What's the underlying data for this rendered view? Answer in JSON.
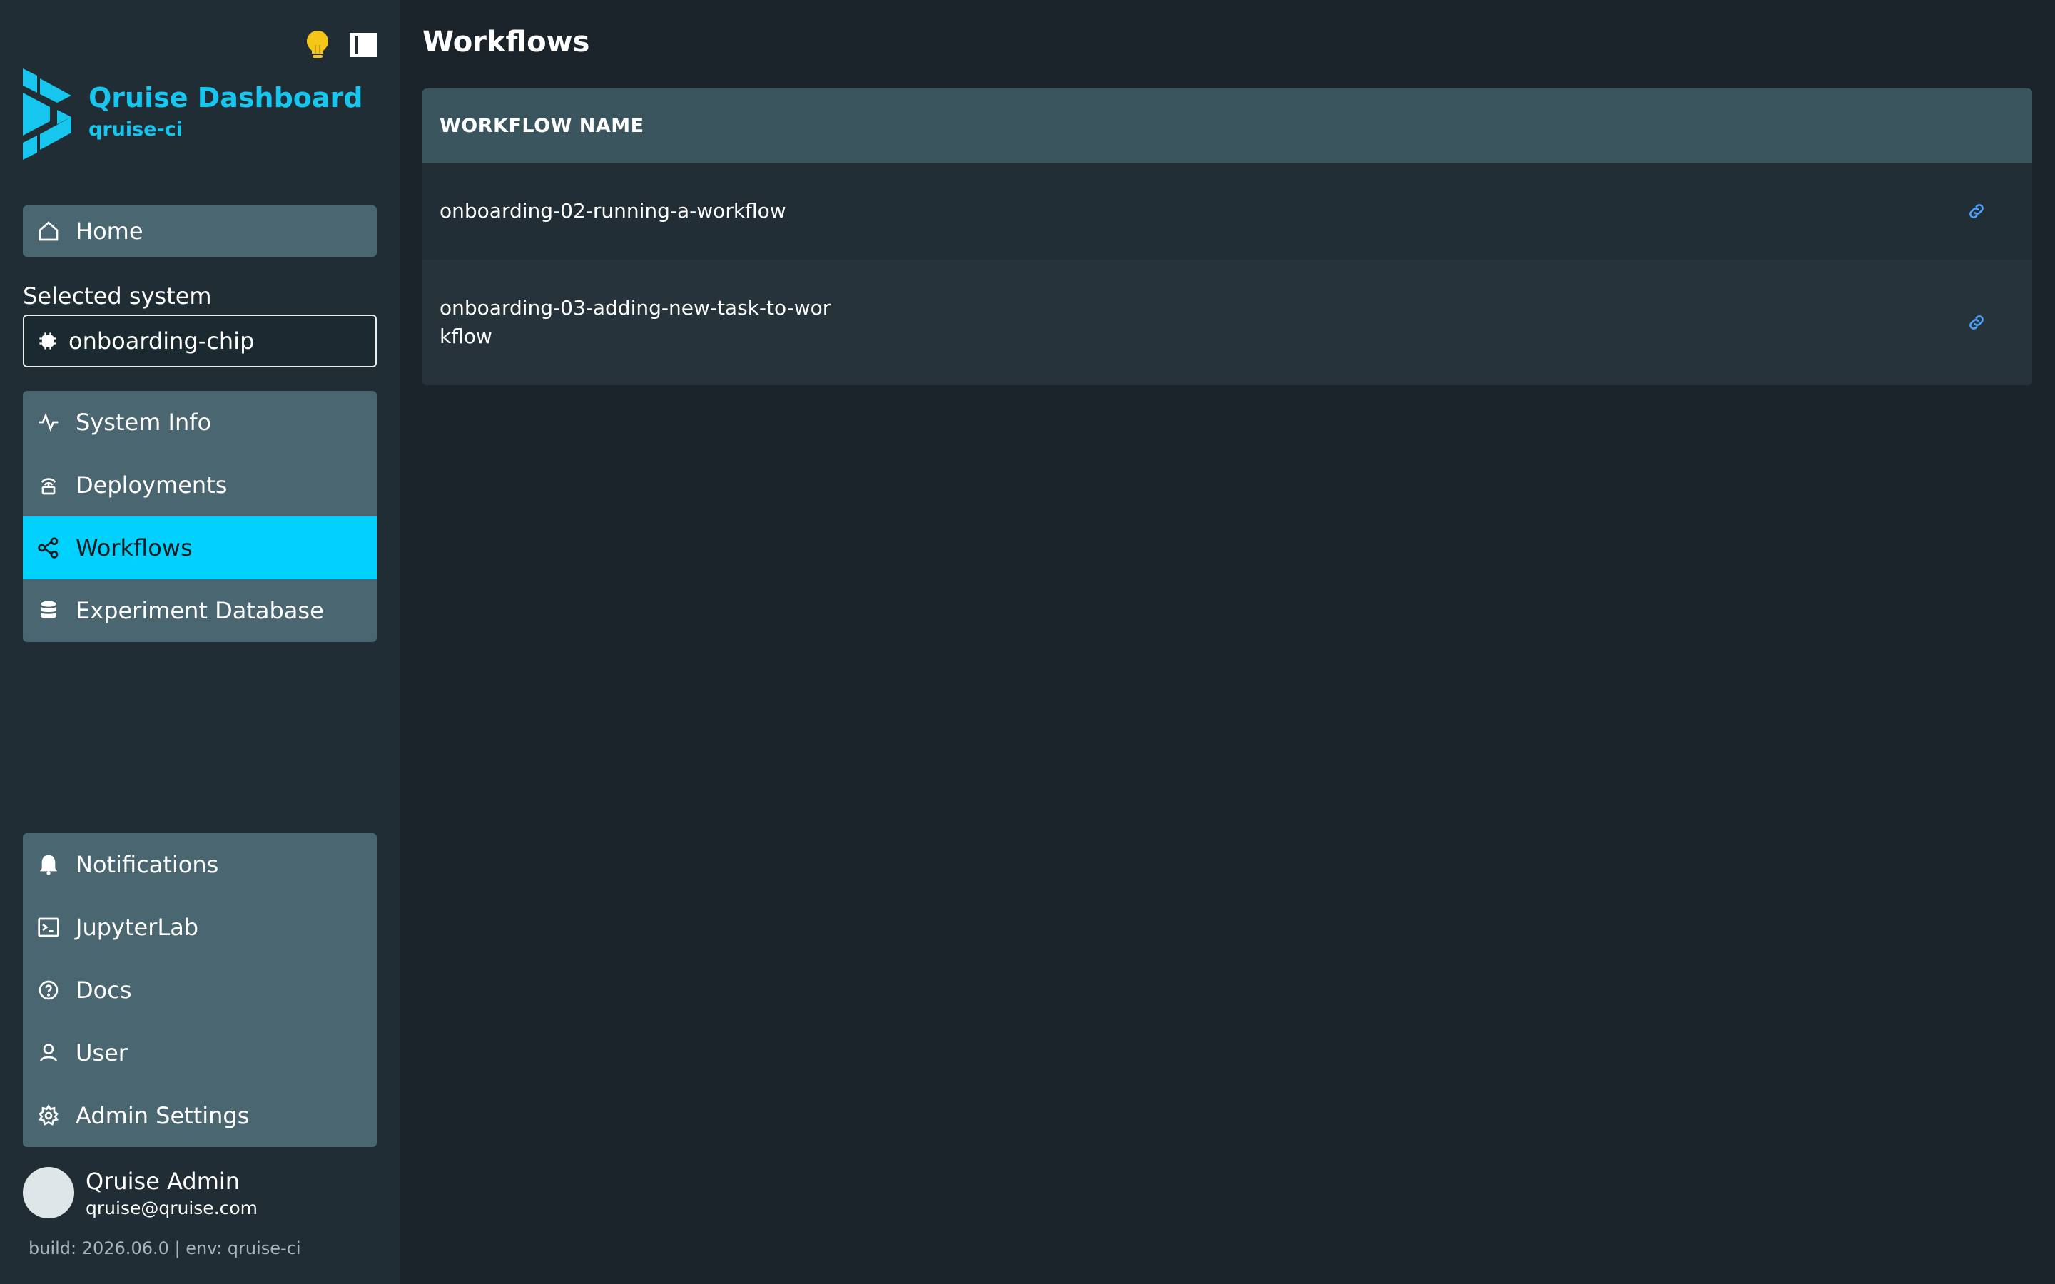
{
  "app": {
    "title": "Qruise Dashboard",
    "subtitle": "qruise-ci"
  },
  "top_icons": [
    "lightbulb-icon",
    "sidebar-toggle-icon"
  ],
  "nav": {
    "home": {
      "label": "Home",
      "icon": "home-icon"
    },
    "selected_system_label": "Selected system",
    "selected_system_value": "onboarding-chip",
    "system_items": [
      {
        "label": "System Info",
        "icon": "activity-icon"
      },
      {
        "label": "Deployments",
        "icon": "deployments-icon"
      },
      {
        "label": "Workflows",
        "icon": "workflow-icon",
        "active": true
      },
      {
        "label": "Experiment Database",
        "icon": "database-icon"
      }
    ],
    "bottom_items": [
      {
        "label": "Notifications",
        "icon": "bell-icon"
      },
      {
        "label": "JupyterLab",
        "icon": "terminal-icon"
      },
      {
        "label": "Docs",
        "icon": "help-circle-icon"
      },
      {
        "label": "User",
        "icon": "user-icon"
      },
      {
        "label": "Admin Settings",
        "icon": "gear-icon"
      }
    ]
  },
  "user": {
    "name": "Qruise Admin",
    "email": "qruise@qruise.com"
  },
  "build_info": "build: 2026.06.0 | env: qruise-ci",
  "main": {
    "title": "Workflows",
    "table": {
      "header": "WORKFLOW NAME",
      "rows": [
        {
          "name": "onboarding-02-running-a-workflow",
          "action_icon": "link-icon"
        },
        {
          "name": "onboarding-03-adding-new-task-to-workflow",
          "action_icon": "link-icon"
        }
      ]
    }
  },
  "colors": {
    "accent": "#00d1ff",
    "brand": "#16c6ef",
    "sidebar_bg": "#212d34",
    "main_bg": "#1b242b",
    "card_bg": "#4a6671",
    "link": "#4aa3ff",
    "bulb": "#f5c518"
  }
}
